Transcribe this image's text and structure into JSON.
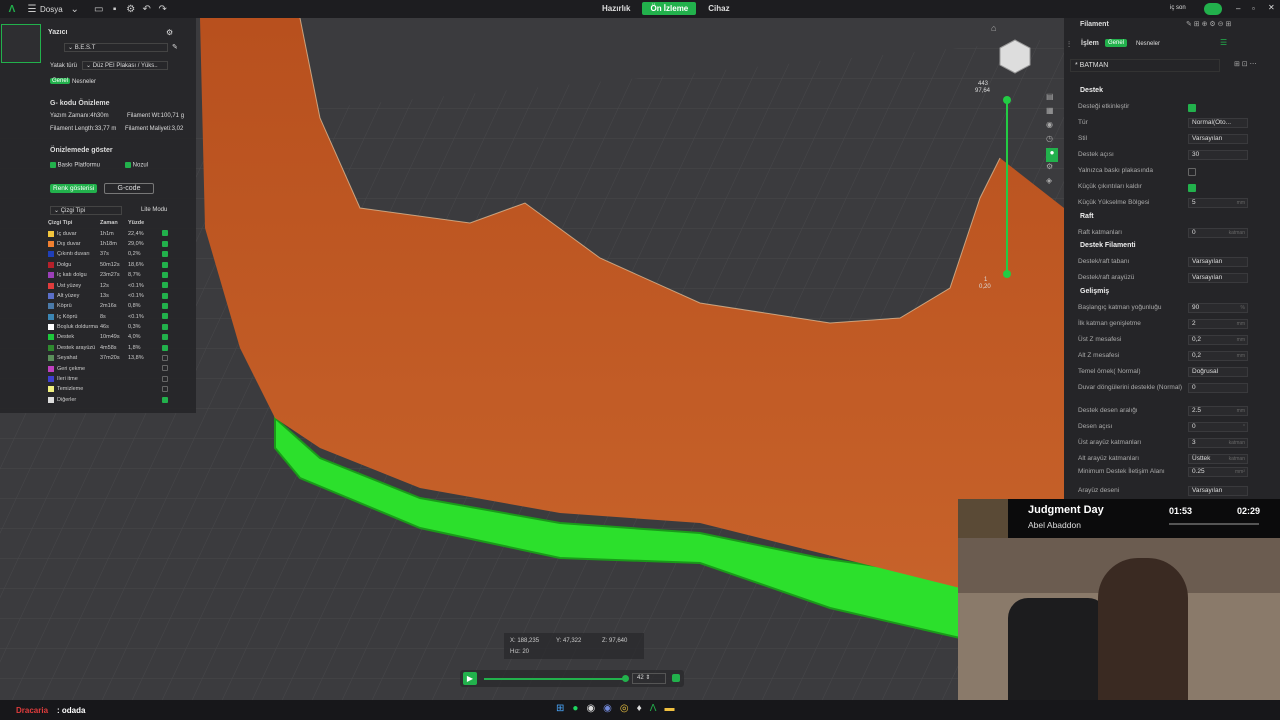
{
  "topbar": {
    "menu_label": "Dosya",
    "tabs": [
      "Hazırlık",
      "Ön İzleme",
      "Cihaz"
    ],
    "active_tab": "Ön İzleme",
    "user_label": "iç son"
  },
  "left_panel": {
    "printer_title": "Yazıcı",
    "printer_name": "B.E.S.T",
    "bed_type_label": "Yatak türü",
    "bed_type_value": "Düz PEI Plakası / Yüks..",
    "tab_general": "Genel",
    "tab_objects": "Nesneler",
    "gcode_preview_title": "G- kodu Önizleme",
    "print_time": "Yazım Zamanı:4h30m",
    "filament_weight": "Filament Wt:100,71 g",
    "filament_length": "Filament Length:33,77 m",
    "filament_cost": "Filament Maliyeti:3,02",
    "show_in_preview_title": "Önizlemede göster",
    "show_bed": "Baskı Platformu",
    "show_nozzle": "Nozul",
    "btn_color_show": "Renk gösterisi",
    "btn_gcode": "G-code",
    "line_type_select": "Çizgi Tipi",
    "lite_mode": "Lite Modu",
    "table_headers": [
      "Çizgi Tipi",
      "Zaman",
      "Yüzde"
    ],
    "legend": [
      {
        "name": "İç duvar",
        "time": "1h1m",
        "pct": "22,4%",
        "color": "#f2c53d",
        "on": true
      },
      {
        "name": "Dış duvar",
        "time": "1h18m",
        "pct": "29,0%",
        "color": "#f08030",
        "on": true
      },
      {
        "name": "Çıkıntı duvarı",
        "time": "37s",
        "pct": "0,2%",
        "color": "#1f3fb8",
        "on": true
      },
      {
        "name": "Dolgu",
        "time": "50m12s",
        "pct": "18,6%",
        "color": "#b5202a",
        "on": true
      },
      {
        "name": "İç katı dolgu",
        "time": "23m27s",
        "pct": "8,7%",
        "color": "#9b3fb8",
        "on": true
      },
      {
        "name": "Üst yüzey",
        "time": "12s",
        "pct": "<0.1%",
        "color": "#e03c3c",
        "on": true
      },
      {
        "name": "Alt yüzey",
        "time": "13s",
        "pct": "<0.1%",
        "color": "#5a6fc8",
        "on": true
      },
      {
        "name": "Köprü",
        "time": "2m16s",
        "pct": "0,8%",
        "color": "#4a7aa8",
        "on": true
      },
      {
        "name": "İç Köprü",
        "time": "8s",
        "pct": "<0.1%",
        "color": "#3c86b4",
        "on": true
      },
      {
        "name": "Boşluk doldurma",
        "time": "46s",
        "pct": "0,3%",
        "color": "#ffffff",
        "on": true
      },
      {
        "name": "Destek",
        "time": "10m49s",
        "pct": "4,0%",
        "color": "#1ec83c",
        "on": true
      },
      {
        "name": "Destek arayüzü",
        "time": "4m58s",
        "pct": "1,8%",
        "color": "#2f8a2f",
        "on": true
      },
      {
        "name": "Seyahat",
        "time": "37m20s",
        "pct": "13,8%",
        "color": "#5a8f5a",
        "on": false
      },
      {
        "name": "Geri çekme",
        "time": "",
        "pct": "",
        "color": "#c040c0",
        "on": false
      },
      {
        "name": "İleri itme",
        "time": "",
        "pct": "",
        "color": "#4040d0",
        "on": false
      },
      {
        "name": "Temizleme",
        "time": "",
        "pct": "",
        "color": "#f0f080",
        "on": false
      },
      {
        "name": "Diğerler",
        "time": "",
        "pct": "",
        "color": "#dddddd",
        "on": true
      }
    ]
  },
  "viewport": {
    "slider_top_label1": "443",
    "slider_top_label2": "97,64",
    "slider_bottom_label1": "1",
    "slider_bottom_label2": "0,20",
    "coord_x": "X: 188,235",
    "coord_y": "Y: 47,322",
    "coord_z": "Z: 97,640",
    "speed": "Hız: 20",
    "layer_value": "42"
  },
  "right_panel": {
    "filament_title": "Filament",
    "process_title": "İşlem",
    "tab_general": "Genel",
    "tab_objects": "Nesneler",
    "preset_name": "* BATMAN",
    "sections": {
      "support": "Destek",
      "raft": "Raft",
      "support_filament": "Destek Filamenti",
      "advanced": "Gelişmiş"
    },
    "fields": [
      {
        "label": "Desteği etkinleştir",
        "kind": "check",
        "value": "",
        "on": true
      },
      {
        "label": "Tür",
        "kind": "select",
        "value": "Normal(Oto..."
      },
      {
        "label": "Stil",
        "kind": "select",
        "value": "Varsayılan"
      },
      {
        "label": "Destek açısı",
        "kind": "input",
        "value": "30",
        "unit": ""
      },
      {
        "label": "Yalnızca baskı plakasında",
        "kind": "check",
        "value": "",
        "on": false
      },
      {
        "label": "Küçük çıkıntıları kaldır",
        "kind": "check",
        "value": "",
        "on": true
      },
      {
        "label": "Küçük Yükselme Bölgesi",
        "kind": "input",
        "value": "5",
        "unit": "mm"
      }
    ],
    "raft_fields": [
      {
        "label": "Raft katmanları",
        "kind": "input",
        "value": "0",
        "unit": "katman"
      }
    ],
    "support_filament_fields": [
      {
        "label": "Destek/raft tabanı",
        "kind": "select",
        "value": "Varsayılan"
      },
      {
        "label": "Destek/raft arayüzü",
        "kind": "select",
        "value": "Varsayılan"
      }
    ],
    "advanced_fields": [
      {
        "label": "Başlangıç katman yoğunluğu",
        "value": "90",
        "unit": "%"
      },
      {
        "label": "İlk katman genişletme",
        "value": "2",
        "unit": "mm"
      },
      {
        "label": "Üst Z mesafesi",
        "value": "0,2",
        "unit": "mm"
      },
      {
        "label": "Alt Z mesafesi",
        "value": "0,2",
        "unit": "mm"
      },
      {
        "label": "Temel örnek( Normal)",
        "value": "Doğrusal",
        "unit": ""
      },
      {
        "label": "Duvar döngülerini destekle (Normal)",
        "value": "0",
        "unit": ""
      },
      {
        "label": "Destek desen aralığı",
        "value": "2.5",
        "unit": "mm"
      },
      {
        "label": "Desen açısı",
        "value": "0",
        "unit": "°"
      },
      {
        "label": "Üst arayüz katmanları",
        "value": "3",
        "unit": "katman"
      },
      {
        "label": "Alt arayüz katmanları",
        "value": "Üsttek",
        "unit": "katman"
      },
      {
        "label": "Minimum Destek İletişim Alanı",
        "value": "0.25",
        "unit": "mm²"
      },
      {
        "label": "Arayüz deseni",
        "value": "Varsayılan",
        "unit": ""
      }
    ]
  },
  "music": {
    "title": "Judgment Day",
    "artist": "Abel Abaddon",
    "elapsed": "01:53",
    "total": "02:29"
  },
  "taskbar": {
    "user": "Dracaria",
    "status": ": odada"
  },
  "colors": {
    "accent": "#22b14c",
    "model": "#c0501e",
    "support": "#2ce02c"
  }
}
